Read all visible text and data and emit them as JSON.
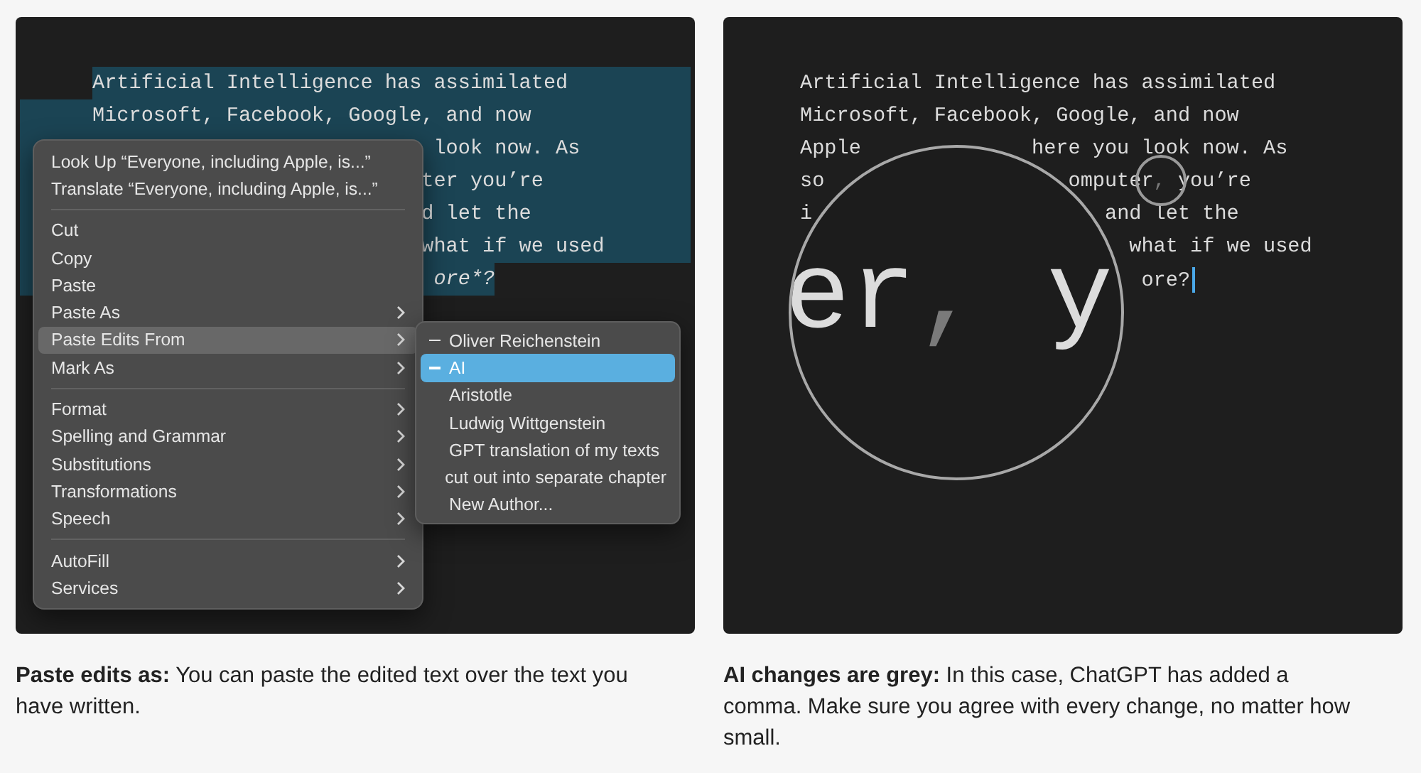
{
  "left_panel": {
    "lines": [
      {
        "selected": true,
        "fragments": [
          {
            "text": "Artificial Intelligence has assimilated",
            "italic": false
          }
        ]
      },
      {
        "selected": true,
        "fragments": [
          {
            "text": "Microsoft, Facebook, Google, and now",
            "italic": false
          }
        ]
      },
      {
        "selected": true,
        "fragments": [
          {
            "text": "look now. As",
            "italic": false
          }
        ]
      },
      {
        "selected": true,
        "fragments": [
          {
            "text": "ter you’re",
            "italic": false
          }
        ]
      },
      {
        "selected": true,
        "fragments": [
          {
            "text": "d let the",
            "italic": false
          }
        ]
      },
      {
        "selected": true,
        "fragments": [
          {
            "text": "what if we used",
            "italic": false
          }
        ]
      },
      {
        "selected": true,
        "fragments": [
          {
            "text": "ore*?",
            "italic": true
          }
        ]
      }
    ],
    "context_menu": {
      "groups": [
        [
          {
            "label": "Look Up “Everyone, including Apple, is...”",
            "submenu": false,
            "selected": false
          },
          {
            "label": "Translate “Everyone, including Apple, is...”",
            "submenu": false,
            "selected": false
          }
        ],
        [
          {
            "label": "Cut",
            "submenu": false,
            "selected": false
          },
          {
            "label": "Copy",
            "submenu": false,
            "selected": false
          },
          {
            "label": "Paste",
            "submenu": false,
            "selected": false
          },
          {
            "label": "Paste As",
            "submenu": true,
            "selected": false
          },
          {
            "label": "Paste Edits From",
            "submenu": true,
            "selected": true
          },
          {
            "label": "Mark As",
            "submenu": true,
            "selected": false
          }
        ],
        [
          {
            "label": "Format",
            "submenu": true,
            "selected": false
          },
          {
            "label": "Spelling and Grammar",
            "submenu": true,
            "selected": false
          },
          {
            "label": "Substitutions",
            "submenu": true,
            "selected": false
          },
          {
            "label": "Transformations",
            "submenu": true,
            "selected": false
          },
          {
            "label": "Speech",
            "submenu": true,
            "selected": false
          }
        ],
        [
          {
            "label": "AutoFill",
            "submenu": true,
            "selected": false
          },
          {
            "label": "Services",
            "submenu": true,
            "selected": false
          }
        ]
      ]
    },
    "submenu": {
      "items": [
        {
          "label": "Oliver Reichenstein",
          "marked": true,
          "selected": false
        },
        {
          "label": "AI",
          "marked": true,
          "selected": true
        },
        {
          "label": "Aristotle",
          "marked": false,
          "selected": false
        },
        {
          "label": "Ludwig Wittgenstein",
          "marked": false,
          "selected": false
        },
        {
          "label": "GPT translation of my texts",
          "marked": false,
          "selected": false
        },
        {
          "label": "cut out into separate chapter",
          "marked": false,
          "selected": false
        },
        {
          "label": "New Author...",
          "marked": false,
          "selected": false
        }
      ]
    }
  },
  "right_panel": {
    "lines": [
      {
        "fragments": [
          [
            {
              "text": "Artificial Intelligence has assimilated",
              "ai": false
            }
          ]
        ]
      },
      {
        "fragments": [
          [
            {
              "text": "Microsoft, Facebook, Google, and now",
              "ai": false
            }
          ]
        ]
      },
      {
        "fragments": [
          [
            {
              "text": "Apple",
              "ai": false
            }
          ],
          [
            {
              "text": "here you look now. As",
              "ai": false
            }
          ]
        ]
      },
      {
        "fragments": [
          [
            {
              "text": "so",
              "ai": false
            }
          ],
          [
            {
              "text": "omputer",
              "ai": false
            },
            {
              "text": ",",
              "ai": true
            },
            {
              "text": " you’re",
              "ai": false
            }
          ]
        ]
      },
      {
        "fragments": [
          [
            {
              "text": "i",
              "ai": false
            }
          ],
          [
            {
              "text": "and let the",
              "ai": false
            }
          ]
        ]
      },
      {
        "fragments": [
          [
            {
              "text": "what if we used",
              "ai": false
            }
          ]
        ]
      },
      {
        "fragments": [
          [
            {
              "text": "ore?",
              "ai": false
            }
          ]
        ]
      }
    ],
    "caret_visible": true,
    "magnifier": {
      "parts": [
        {
          "text": "er",
          "ai": false
        },
        {
          "text": ",",
          "ai": true
        },
        {
          "text": " y",
          "ai": false
        }
      ]
    }
  },
  "captions": [
    "**Paste edits as:** You can paste the edited text over the text you have written.",
    "**AI changes are grey:** In this case, ChatGPT has added a comma. Make sure you agree with every change, no matter how small."
  ]
}
